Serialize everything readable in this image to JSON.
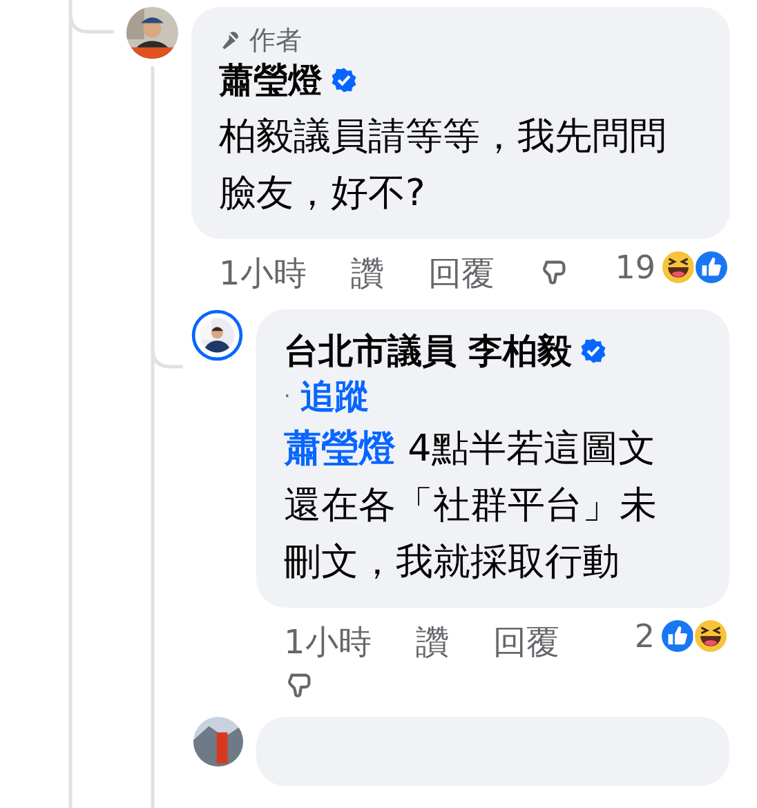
{
  "comments": [
    {
      "avatar_ring": false,
      "author_badge": "作者",
      "name": "蕭瑩燈",
      "verified": true,
      "text": "柏毅議員請等等，我先問問臉友，好不?",
      "time": "1小時",
      "like": "讚",
      "reply": "回覆",
      "reaction_count": "19",
      "reactions": [
        {
          "kind": "haha"
        },
        {
          "kind": "like"
        }
      ]
    },
    {
      "avatar_ring": true,
      "name": "台北市議員 李柏毅",
      "verified": true,
      "follow_separator": "·",
      "follow": "追蹤",
      "mention": "蕭瑩燈",
      "text": "4點半若這圖文還在各「社群平台」未刪文，我就採取行動",
      "time": "1小時",
      "like": "讚",
      "reply": "回覆",
      "reaction_count": "2",
      "reactions": [
        {
          "kind": "like"
        },
        {
          "kind": "haha"
        }
      ]
    }
  ]
}
